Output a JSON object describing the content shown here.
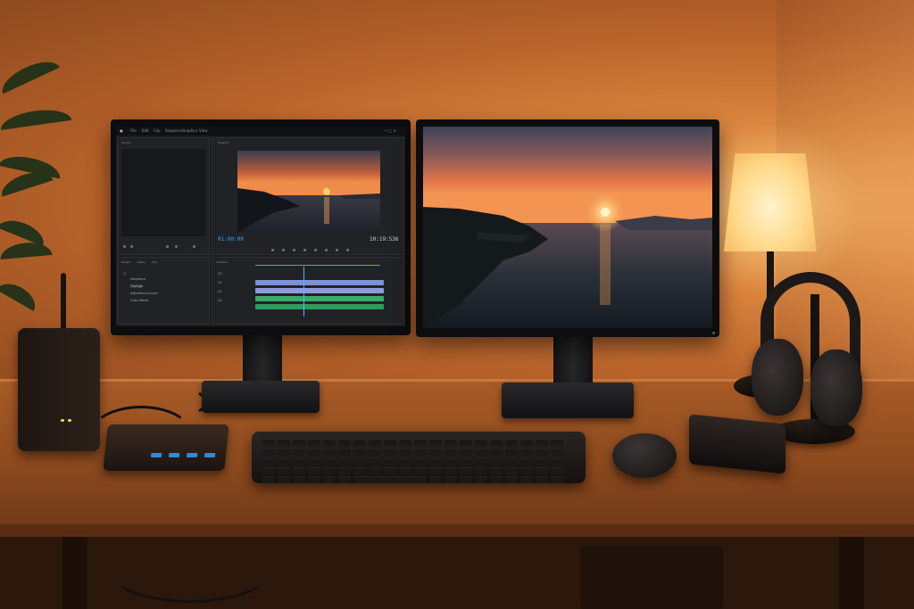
{
  "scene": {
    "description_tag": "desk-setup"
  },
  "left_monitor": {
    "menu": [
      "File",
      "Edit",
      "Clip",
      "Sequence",
      "Graphics",
      "View"
    ],
    "window_title": "",
    "source_tab": "Source",
    "program_tab": "Program",
    "timecode_left": "01:00:09",
    "timecode_right": "10:19:536",
    "project_tabs": [
      "Project",
      "Media",
      "Info"
    ],
    "files": [
      "Sequence",
      "Footage",
      "Adjustment Layer",
      "Color Matte"
    ],
    "timeline_tab": "Timeline",
    "track_labels": [
      "V2",
      "V1",
      "A1",
      "A2"
    ]
  },
  "colors": {
    "accent_timecode": "#3aa6ff",
    "video_track": "#7f8fd9",
    "audio_track": "#3aa96b",
    "playhead": "#5fb0ff"
  }
}
